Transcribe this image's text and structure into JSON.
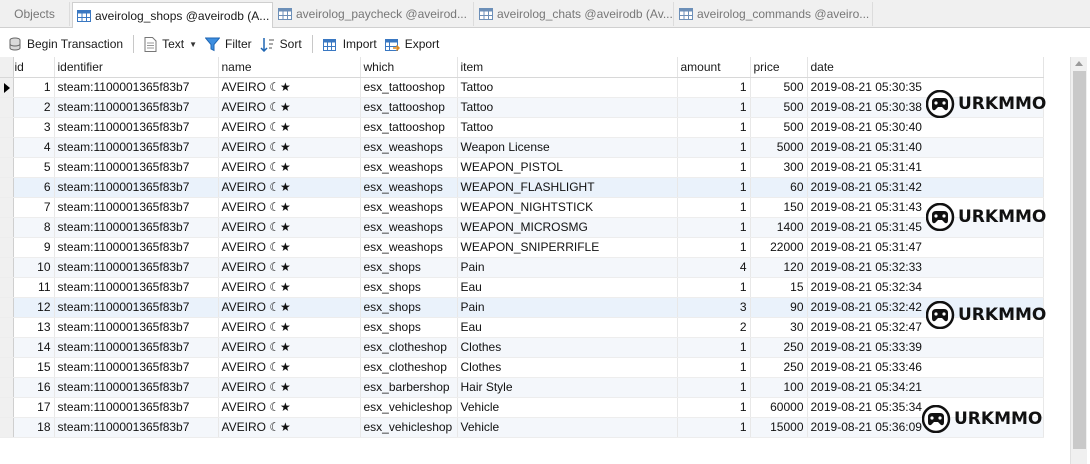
{
  "tabs": [
    {
      "label": "Objects",
      "active": false
    },
    {
      "label": "aveirolog_shops @aveirodb (A...",
      "active": true
    },
    {
      "label": "aveirolog_paycheck @aveirod...",
      "active": false
    },
    {
      "label": "aveirolog_chats @aveirodb (Av...",
      "active": false
    },
    {
      "label": "aveirolog_commands @aveiro...",
      "active": false
    }
  ],
  "toolbar": {
    "begin_transaction": "Begin Transaction",
    "text": "Text",
    "filter": "Filter",
    "sort": "Sort",
    "import": "Import",
    "export": "Export"
  },
  "columns": [
    "id",
    "identifier",
    "name",
    "which",
    "item",
    "amount",
    "price",
    "date"
  ],
  "rows": [
    {
      "id": "1",
      "identifier": "steam:1100001365f83b7",
      "name": "AVEIRO ☾★",
      "which": "esx_tattooshop",
      "item": "Tattoo",
      "amount": "1",
      "price": "500",
      "date": "2019-08-21 05:30:35"
    },
    {
      "id": "2",
      "identifier": "steam:1100001365f83b7",
      "name": "AVEIRO ☾★",
      "which": "esx_tattooshop",
      "item": "Tattoo",
      "amount": "1",
      "price": "500",
      "date": "2019-08-21 05:30:38"
    },
    {
      "id": "3",
      "identifier": "steam:1100001365f83b7",
      "name": "AVEIRO ☾★",
      "which": "esx_tattooshop",
      "item": "Tattoo",
      "amount": "1",
      "price": "500",
      "date": "2019-08-21 05:30:40"
    },
    {
      "id": "4",
      "identifier": "steam:1100001365f83b7",
      "name": "AVEIRO ☾★",
      "which": "esx_weashops",
      "item": "Weapon License",
      "amount": "1",
      "price": "5000",
      "date": "2019-08-21 05:31:40"
    },
    {
      "id": "5",
      "identifier": "steam:1100001365f83b7",
      "name": "AVEIRO ☾★",
      "which": "esx_weashops",
      "item": "WEAPON_PISTOL",
      "amount": "1",
      "price": "300",
      "date": "2019-08-21 05:31:41"
    },
    {
      "id": "6",
      "identifier": "steam:1100001365f83b7",
      "name": "AVEIRO ☾★",
      "which": "esx_weashops",
      "item": "WEAPON_FLASHLIGHT",
      "amount": "1",
      "price": "60",
      "date": "2019-08-21 05:31:42"
    },
    {
      "id": "7",
      "identifier": "steam:1100001365f83b7",
      "name": "AVEIRO ☾★",
      "which": "esx_weashops",
      "item": "WEAPON_NIGHTSTICK",
      "amount": "1",
      "price": "150",
      "date": "2019-08-21 05:31:43"
    },
    {
      "id": "8",
      "identifier": "steam:1100001365f83b7",
      "name": "AVEIRO ☾★",
      "which": "esx_weashops",
      "item": "WEAPON_MICROSMG",
      "amount": "1",
      "price": "1400",
      "date": "2019-08-21 05:31:45"
    },
    {
      "id": "9",
      "identifier": "steam:1100001365f83b7",
      "name": "AVEIRO ☾★",
      "which": "esx_weashops",
      "item": "WEAPON_SNIPERRIFLE",
      "amount": "1",
      "price": "22000",
      "date": "2019-08-21 05:31:47"
    },
    {
      "id": "10",
      "identifier": "steam:1100001365f83b7",
      "name": "AVEIRO ☾★",
      "which": "esx_shops",
      "item": "Pain",
      "amount": "4",
      "price": "120",
      "date": "2019-08-21 05:32:33"
    },
    {
      "id": "11",
      "identifier": "steam:1100001365f83b7",
      "name": "AVEIRO ☾★",
      "which": "esx_shops",
      "item": "Eau",
      "amount": "1",
      "price": "15",
      "date": "2019-08-21 05:32:34"
    },
    {
      "id": "12",
      "identifier": "steam:1100001365f83b7",
      "name": "AVEIRO ☾★",
      "which": "esx_shops",
      "item": "Pain",
      "amount": "3",
      "price": "90",
      "date": "2019-08-21 05:32:42"
    },
    {
      "id": "13",
      "identifier": "steam:1100001365f83b7",
      "name": "AVEIRO ☾★",
      "which": "esx_shops",
      "item": "Eau",
      "amount": "2",
      "price": "30",
      "date": "2019-08-21 05:32:47"
    },
    {
      "id": "14",
      "identifier": "steam:1100001365f83b7",
      "name": "AVEIRO ☾★",
      "which": "esx_clotheshop",
      "item": "Clothes",
      "amount": "1",
      "price": "250",
      "date": "2019-08-21 05:33:39"
    },
    {
      "id": "15",
      "identifier": "steam:1100001365f83b7",
      "name": "AVEIRO ☾★",
      "which": "esx_clotheshop",
      "item": "Clothes",
      "amount": "1",
      "price": "250",
      "date": "2019-08-21 05:33:46"
    },
    {
      "id": "16",
      "identifier": "steam:1100001365f83b7",
      "name": "AVEIRO ☾★",
      "which": "esx_barbershop",
      "item": "Hair Style",
      "amount": "1",
      "price": "100",
      "date": "2019-08-21 05:34:21"
    },
    {
      "id": "17",
      "identifier": "steam:1100001365f83b7",
      "name": "AVEIRO ☾★",
      "which": "esx_vehicleshop",
      "item": "Vehicle",
      "amount": "1",
      "price": "60000",
      "date": "2019-08-21 05:35:34"
    },
    {
      "id": "18",
      "identifier": "steam:1100001365f83b7",
      "name": "AVEIRO ☾★",
      "which": "esx_vehicleshop",
      "item": "Vehicle",
      "amount": "1",
      "price": "15000",
      "date": "2019-08-21 05:36:09"
    }
  ],
  "watermark": {
    "text": "URKMMO"
  },
  "colors": {
    "accent": "#1e6fd0",
    "row_alt": "#f4f7fb"
  }
}
